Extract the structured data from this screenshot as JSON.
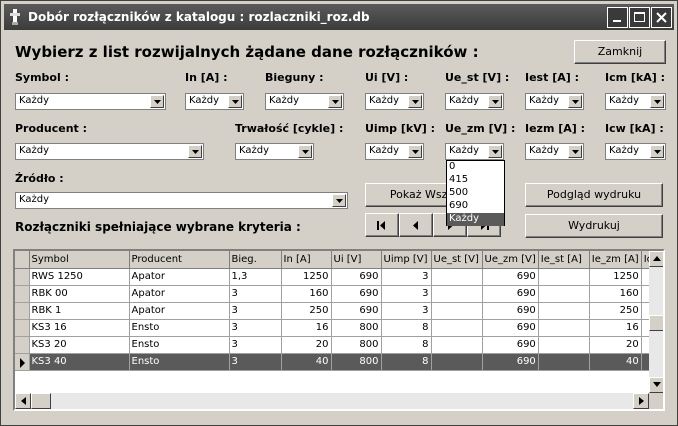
{
  "window": {
    "title": "Dobór rozłączników z katalogu : rozlaczniki_roz.db",
    "controls": [
      "minimize-icon",
      "maximize-icon",
      "close-icon"
    ]
  },
  "heading": "Wybierz z list rozwijalnych żądane dane rozłączników :",
  "close_button": "Zamknij",
  "filters": {
    "symbol": {
      "label": "Symbol :",
      "value": "Każdy"
    },
    "in": {
      "label": "In [A] :",
      "value": "Każdy"
    },
    "bieguny": {
      "label": "Bieguny :",
      "value": "Każdy"
    },
    "ui": {
      "label": "Ui [V] :",
      "value": "Każdy"
    },
    "ue_st": {
      "label": "Ue_st [V] :",
      "value": "Każdy"
    },
    "iest": {
      "label": "Iest [A] :",
      "value": "Każdy"
    },
    "icm": {
      "label": "Icm [kA] :",
      "value": "Każdy"
    },
    "producent": {
      "label": "Producent :",
      "value": "Każdy"
    },
    "trwalosc": {
      "label": "Trwałość [cykle] :",
      "value": "Każdy"
    },
    "uimp": {
      "label": "Uimp [kV] :",
      "value": "Każdy"
    },
    "ue_zm": {
      "label": "Ue_zm [V] :",
      "value": "Każdy"
    },
    "iezm": {
      "label": "Iezm [A] :",
      "value": "Każdy"
    },
    "icw": {
      "label": "Icw [kA] :",
      "value": "Każdy"
    },
    "zrodlo": {
      "label": "Źródło :",
      "value": "Każdy"
    }
  },
  "ue_zm_dropdown": {
    "options": [
      "0",
      "415",
      "500",
      "690",
      "Każdy"
    ],
    "selected": "Każdy"
  },
  "buttons": {
    "show": "Pokaż Wszystkie",
    "preview": "Podgląd wydruku",
    "print": "Wydrukuj"
  },
  "results_heading": "Rozłączniki spełniające wybrane kryteria :",
  "navigator_icons": [
    "first-record-icon",
    "prior-record-icon",
    "next-record-icon",
    "last-record-icon"
  ],
  "grid": {
    "columns": [
      "Symbol",
      "Producent",
      "Bieg.",
      "In [A]",
      "Ui [V]",
      "Uimp [V]",
      "Ue_st [V]",
      "Ue_zm [V]",
      "Ie_st [A]",
      "Ie_zm [A]",
      "Ic"
    ],
    "rows": [
      [
        "RWS 1250",
        "Apator",
        "1,3",
        "1250",
        "690",
        "3",
        "",
        "690",
        "",
        "1250",
        ""
      ],
      [
        "RBK 00",
        "Apator",
        "3",
        "160",
        "690",
        "3",
        "",
        "690",
        "",
        "160",
        ""
      ],
      [
        "RBK 1",
        "Apator",
        "3",
        "250",
        "690",
        "3",
        "",
        "690",
        "",
        "250",
        ""
      ],
      [
        "KS3 16",
        "Ensto",
        "3",
        "16",
        "800",
        "8",
        "",
        "690",
        "",
        "16",
        ""
      ],
      [
        "KS3 20",
        "Ensto",
        "3",
        "20",
        "800",
        "8",
        "",
        "690",
        "",
        "20",
        ""
      ],
      [
        "KS3 40",
        "Ensto",
        "3",
        "40",
        "800",
        "8",
        "",
        "690",
        "",
        "40",
        ""
      ]
    ],
    "selected_row": 5
  },
  "colors": {
    "face": "#d4d0c8",
    "titlebar": "#4a4a4a",
    "selection": "#5a5a5a"
  }
}
